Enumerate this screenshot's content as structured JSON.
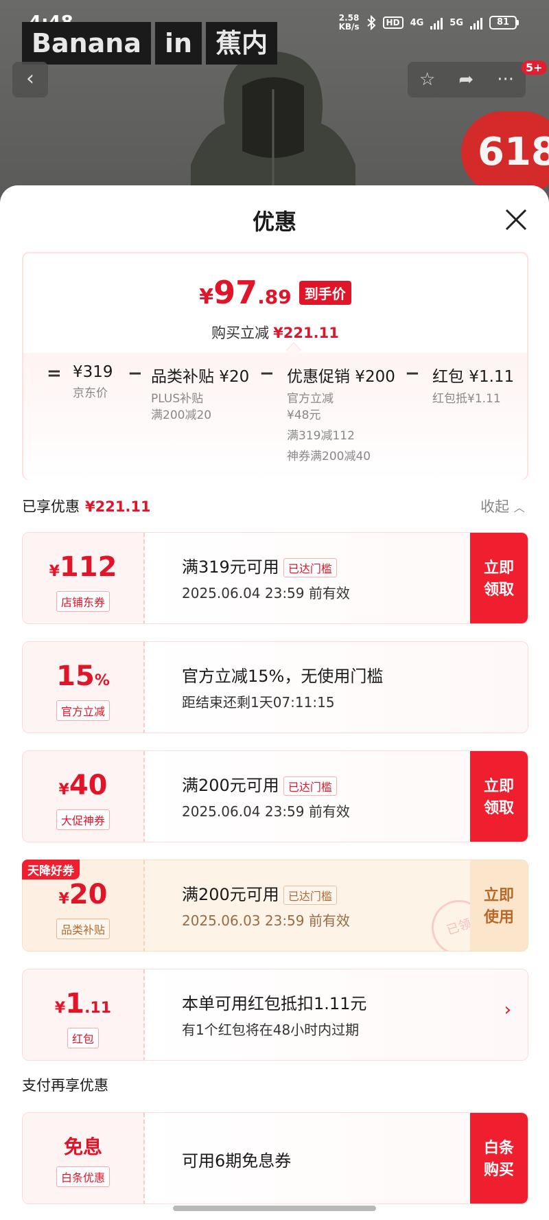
{
  "status_bar": {
    "time": "4:48",
    "net_speed_value": "2.58",
    "net_speed_unit": "KB/s",
    "hd_label": "HD",
    "net1": "4G",
    "net2": "5G",
    "battery": "81"
  },
  "watermark": [
    "Banana",
    "in",
    "蕉内"
  ],
  "header_badge": "5+",
  "promo_badge": "618",
  "sheet": {
    "title": "优惠"
  },
  "price_summary": {
    "currency": "¥",
    "price_int": "97",
    "price_dec": ".89",
    "price_tag": "到手价",
    "reduce_label": "购买立减",
    "reduce_amount": "¥221.11"
  },
  "calc": {
    "equals": "=",
    "minus": "−",
    "items": [
      {
        "main": "¥319",
        "subs": [
          "京东价"
        ]
      },
      {
        "main": "品类补贴 ¥20",
        "subs": [
          "PLUS补贴",
          "满200减20"
        ]
      },
      {
        "main": "优惠促销 ¥200",
        "subs": [
          "官方立减",
          "¥48元",
          "满319减112",
          "神券满200减40"
        ]
      },
      {
        "main": "红包 ¥1.11",
        "subs": [
          "红包抵¥1.11"
        ]
      }
    ]
  },
  "enjoyed": {
    "label": "已享优惠",
    "amount": "¥221.11",
    "collapse_label": "收起"
  },
  "coupons": [
    {
      "yen": "¥",
      "amount": "112",
      "tag": "店铺东券",
      "title": "满319元可用",
      "threshold": "已达门槛",
      "sub": "2025.06.04 23:59 前有效",
      "cta": [
        "立即",
        "领取"
      ]
    },
    {
      "amount": "15",
      "pct": "%",
      "tag": "官方立减",
      "title": "官方立减15%，无使用门槛",
      "sub": "距结束还剩1天07:11:15"
    },
    {
      "yen": "¥",
      "amount": "40",
      "tag": "大促神券",
      "title": "满200元可用",
      "threshold": "已达门槛",
      "sub": "2025.06.04 23:59 前有效",
      "cta": [
        "立即",
        "领取"
      ]
    },
    {
      "yen": "¥",
      "amount": "20",
      "tag": "品类补贴",
      "sky_label": "天降好券",
      "title": "满200元可用",
      "threshold": "已达门槛",
      "sub": "2025.06.03 23:59 前有效",
      "cta": [
        "立即",
        "使用"
      ],
      "stamp": "已领"
    },
    {
      "yen": "¥",
      "amount": "1",
      "dec": ".11",
      "tag": "红包",
      "title": "本单可用红包抵扣1.11元",
      "sub": "有1个红包将在48小时内过期"
    }
  ],
  "pay_section": {
    "label": "支付再享优惠",
    "coupon": {
      "amount": "免息",
      "tag": "白条优惠",
      "title": "可用6期免息券",
      "cta": [
        "白条",
        "购买"
      ]
    }
  },
  "colors": {
    "brand_red": "#e0152a",
    "cta_red": "#ef1f30",
    "gold_text": "#b66a2a"
  }
}
